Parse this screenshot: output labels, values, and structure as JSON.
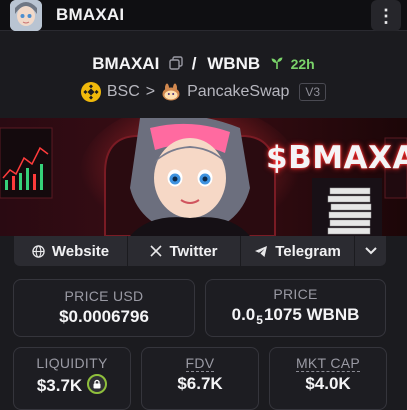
{
  "header": {
    "app_name": "BMAXAI",
    "menu_icon": "kebab-menu-icon"
  },
  "pair": {
    "base": "BMAXAI",
    "separator": "/",
    "quote": "WBNB",
    "age": "22h"
  },
  "chain": {
    "network": "BSC",
    "arrow": ">",
    "dex": "PancakeSwap",
    "version": "V3"
  },
  "banner": {
    "headline": "$BMAXAI"
  },
  "links": {
    "website": "Website",
    "twitter": "Twitter",
    "telegram": "Telegram"
  },
  "stats": {
    "price_usd": {
      "label": "PRICE USD",
      "value": "$0.0006796"
    },
    "price_native": {
      "label": "PRICE",
      "value_prefix": "0.0",
      "value_sub": "5",
      "value_rest": "1075 WBNB"
    },
    "liquidity": {
      "label": "LIQUIDITY",
      "value": "$3.7K"
    },
    "fdv": {
      "label": "FDV",
      "value": "$6.7K"
    },
    "mkt_cap": {
      "label": "MKT CAP",
      "value": "$4.0K"
    }
  },
  "colors": {
    "accent_green": "#7ad36a",
    "banner_red": "#ff2a2a",
    "bsc_yellow": "#f0b90b"
  }
}
